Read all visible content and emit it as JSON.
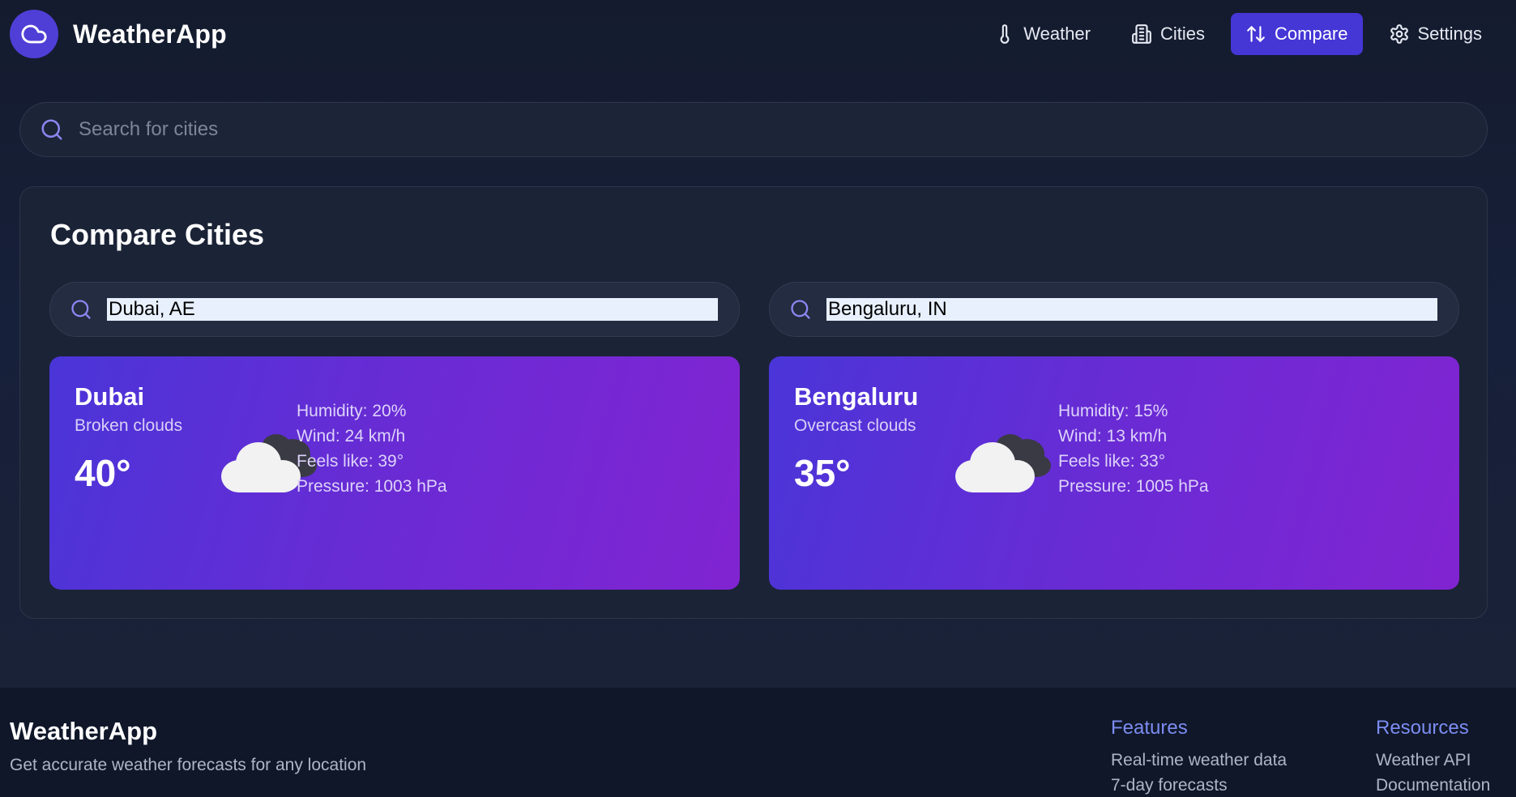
{
  "header": {
    "brand": "WeatherApp",
    "nav": [
      {
        "label": "Weather",
        "icon": "thermometer-icon",
        "active": false
      },
      {
        "label": "Cities",
        "icon": "building-icon",
        "active": false
      },
      {
        "label": "Compare",
        "icon": "swap-arrows-icon",
        "active": true
      },
      {
        "label": "Settings",
        "icon": "gear-icon",
        "active": false
      }
    ]
  },
  "search": {
    "placeholder": "Search for cities"
  },
  "compare": {
    "title": "Compare Cities",
    "left": {
      "query": "Dubai, AE",
      "city": "Dubai",
      "condition": "Broken clouds",
      "temp": "40°",
      "humidity": "Humidity: 20%",
      "wind": "Wind: 24 km/h",
      "feels_like": "Feels like: 39°",
      "pressure": "Pressure: 1003 hPa"
    },
    "right": {
      "query": "Bengaluru, IN",
      "city": "Bengaluru",
      "condition": "Overcast clouds",
      "temp": "35°",
      "humidity": "Humidity: 15%",
      "wind": "Wind: 13 km/h",
      "feels_like": "Feels like: 33°",
      "pressure": "Pressure: 1005 hPa"
    }
  },
  "footer": {
    "brand": "WeatherApp",
    "tagline": "Get accurate weather forecasts for any location",
    "features": {
      "title": "Features",
      "items": [
        "Real-time weather data",
        "7-day forecasts"
      ]
    },
    "resources": {
      "title": "Resources",
      "items": [
        "Weather API",
        "Documentation"
      ]
    }
  },
  "colors": {
    "accent": "#4536d6",
    "card_start": "#4a35d8",
    "card_end": "#8124d2",
    "footer_heading": "#7d8cf2"
  }
}
